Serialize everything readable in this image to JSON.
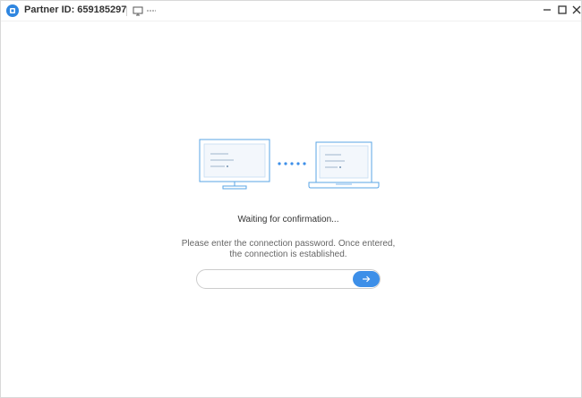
{
  "titlebar": {
    "title": "Partner ID: 659185297",
    "icons": [
      "app-logo-icon",
      "screen-icon",
      "more-icon",
      "minimize-icon",
      "maximize-icon",
      "close-icon"
    ]
  },
  "main": {
    "status": "Waiting for confirmation...",
    "instructions": [
      "Please enter the connection password. Once entered,",
      "the connection is established."
    ],
    "password": {
      "value": "",
      "placeholder": ""
    },
    "submit_icon": "arrow-right-icon"
  },
  "colors": {
    "accent": "#3d8fe8",
    "illustration_stroke": "#5aa5e6",
    "text_primary": "#333333",
    "text_secondary": "#666666"
  }
}
